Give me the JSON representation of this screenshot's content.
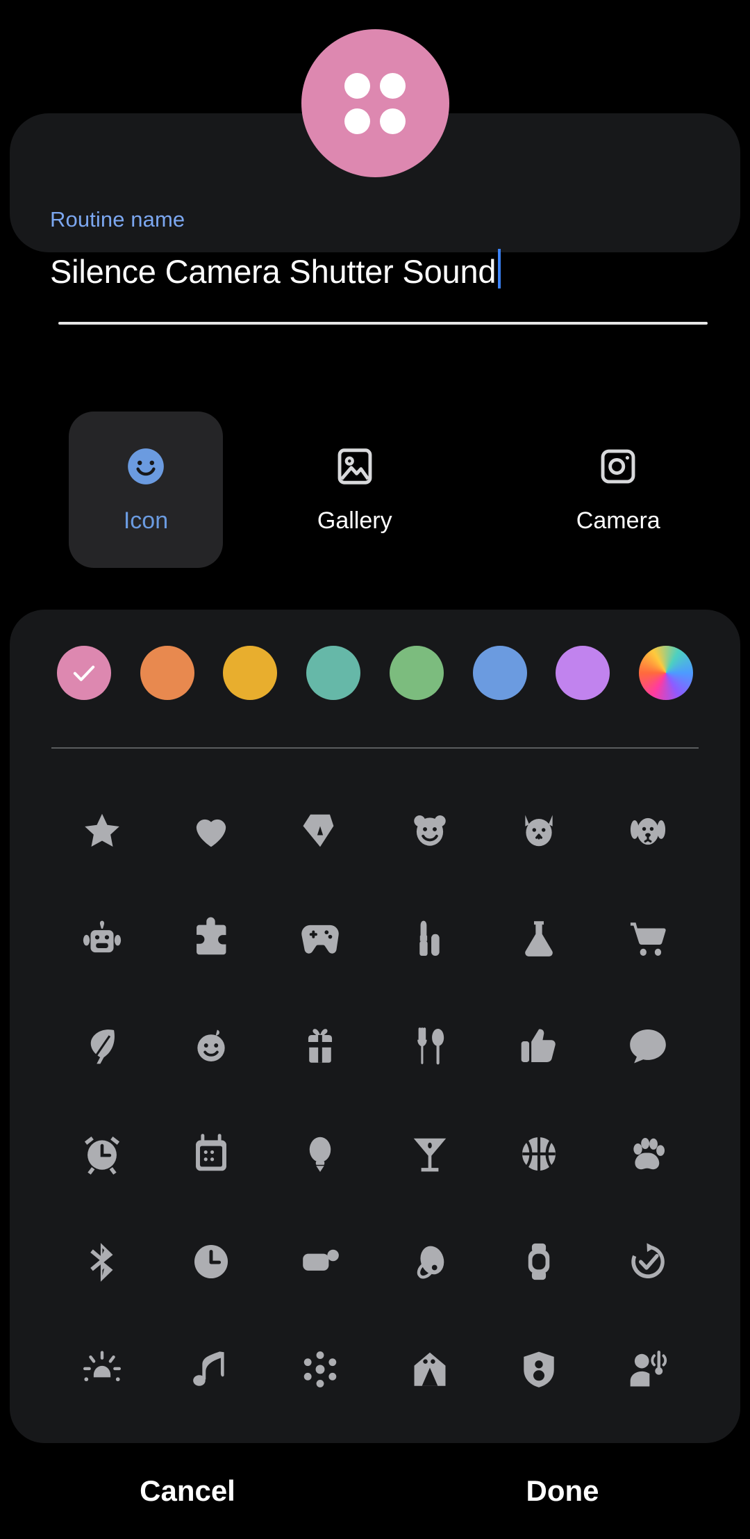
{
  "avatar": {
    "name": "routine-avatar-preview",
    "background_color": "#DD88B0",
    "icon": "four-dot-grid-icon",
    "dot_color": "#FFFFFF"
  },
  "name_card": {
    "label": "Routine name",
    "value": "Silence Camera Shutter Sound",
    "placeholder": "Routine name",
    "label_color": "#7CA7F0",
    "caret_color": "#3B82F6",
    "underline_color": "#E6E6E6"
  },
  "source_tabs": {
    "selected": "Icon",
    "items": [
      {
        "label": "Icon",
        "icon": "smiley-face-icon",
        "selected": true
      },
      {
        "label": "Gallery",
        "icon": "image-picture-icon",
        "selected": false
      },
      {
        "label": "Camera",
        "icon": "camera-icon",
        "selected": false
      }
    ],
    "selected_color": "#6B9BE0",
    "selected_bg": "#252527"
  },
  "color_swatches": {
    "selected_index": 0,
    "items": [
      {
        "name": "pink",
        "color": "#DD88B0",
        "selected": true
      },
      {
        "name": "orange",
        "color": "#E8894F",
        "selected": false
      },
      {
        "name": "amber",
        "color": "#E8AE2E",
        "selected": false
      },
      {
        "name": "teal",
        "color": "#66B8A8",
        "selected": false
      },
      {
        "name": "green",
        "color": "#7CBC7E",
        "selected": false
      },
      {
        "name": "blue",
        "color": "#6B9BE0",
        "selected": false
      },
      {
        "name": "purple",
        "color": "#C183EE",
        "selected": false
      },
      {
        "name": "rainbow",
        "color": "gradient",
        "selected": false
      }
    ]
  },
  "icon_grid": {
    "icon_color": "#ADAEB2",
    "columns": 6,
    "rows": 6,
    "icons": [
      "star-icon",
      "heart-icon",
      "pen-nib-icon",
      "bear-face-icon",
      "cat-face-icon",
      "dog-face-icon",
      "robot-icon",
      "puzzle-piece-icon",
      "game-controller-icon",
      "lipstick-makeup-icon",
      "flask-icon",
      "shopping-cart-icon",
      "leaf-icon",
      "baby-face-icon",
      "gift-icon",
      "fork-spoon-icon",
      "thumbs-up-icon",
      "speech-bubble-icon",
      "alarm-clock-icon",
      "calendar-icon",
      "light-bulb-icon",
      "cocktail-glass-icon",
      "basketball-icon",
      "paw-print-icon",
      "bluetooth-icon",
      "clock-icon",
      "battery-notification-icon",
      "earbud-icon",
      "smartwatch-icon",
      "refresh-check-icon",
      "brightness-icon",
      "music-note-icon",
      "hub-network-icon",
      "smart-home-icon",
      "shield-person-icon",
      "person-signal-icon"
    ]
  },
  "footer": {
    "cancel_label": "Cancel",
    "done_label": "Done"
  }
}
